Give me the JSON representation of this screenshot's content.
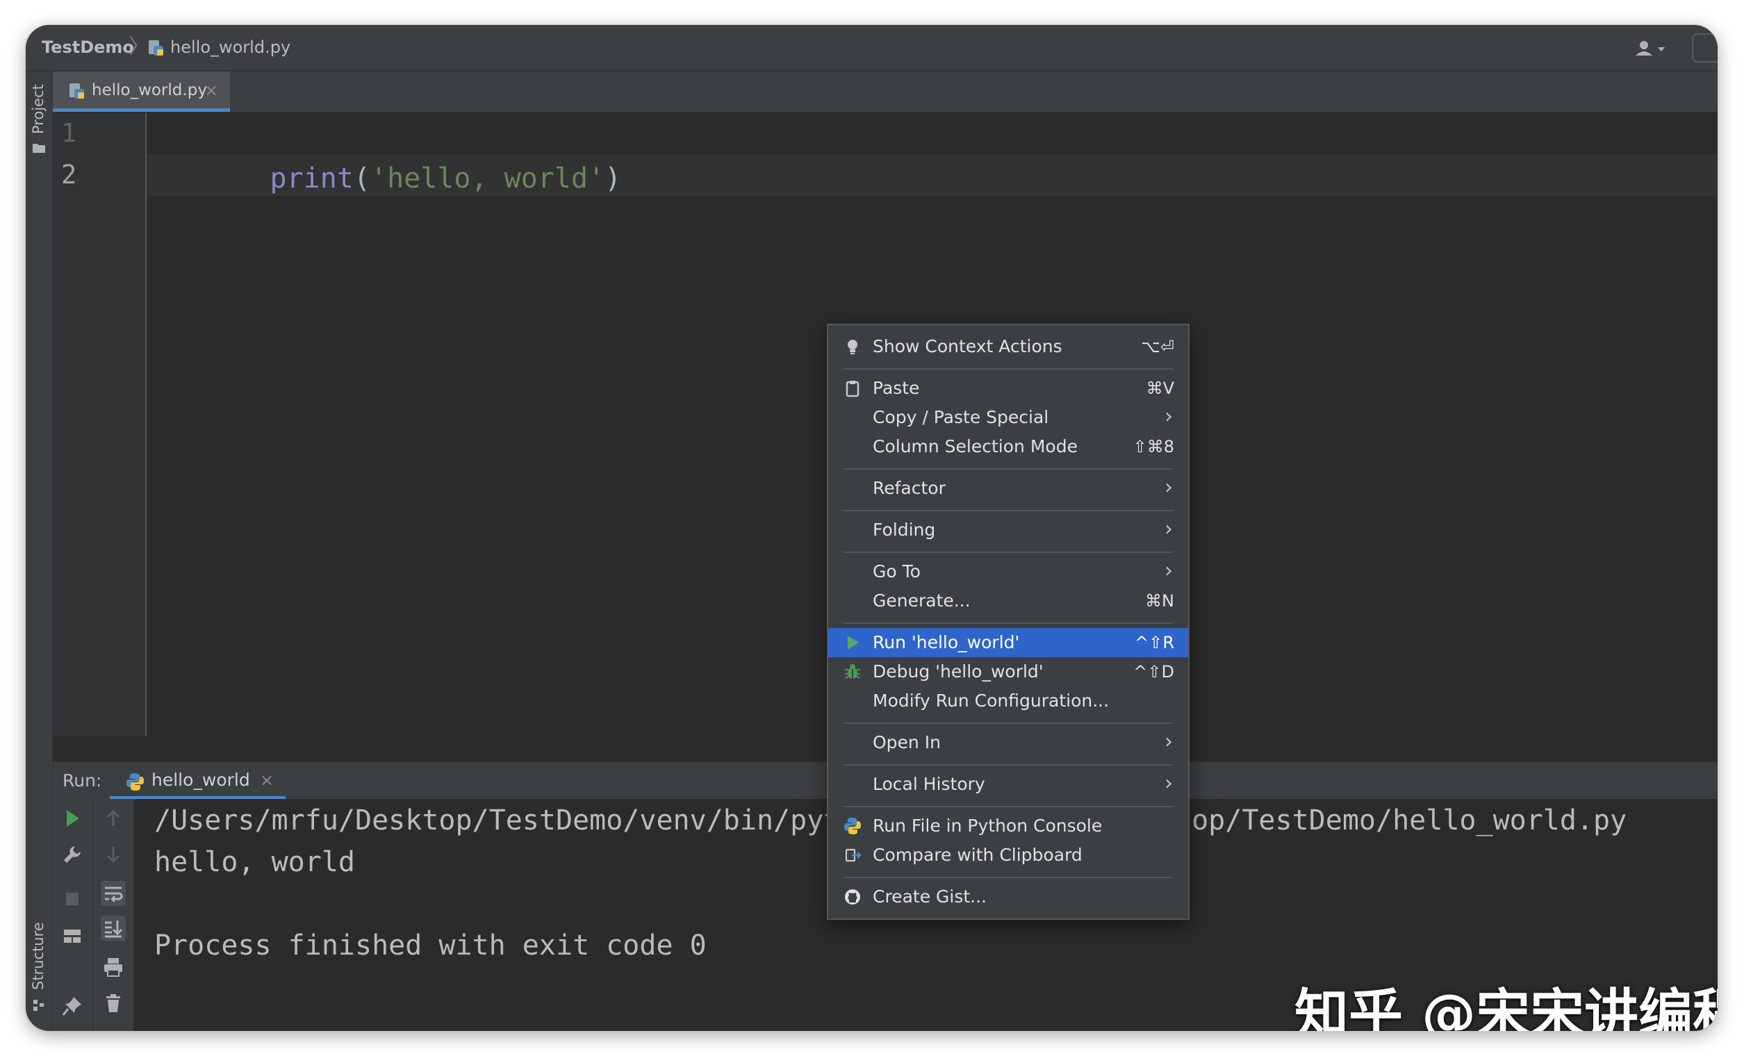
{
  "breadcrumb": {
    "project": "TestDemo",
    "file": "hello_world.py"
  },
  "sidebar": {
    "project_label": "Project",
    "structure_label": "Structure"
  },
  "editor": {
    "tab_label": "hello_world.py",
    "tab_close": "×",
    "line_numbers": [
      "1",
      "2"
    ],
    "code": {
      "fn": "print",
      "open": "(",
      "str": "'hello, world'",
      "close": ")"
    }
  },
  "run_panel": {
    "label": "Run:",
    "tab_label": "hello_world",
    "tab_close": "×",
    "console_lines": [
      "/Users/mrfu/Desktop/TestDemo/venv/bin/python /Users/mrfu/Desktop/TestDemo/hello_world.py",
      "hello, world",
      "",
      "Process finished with exit code 0"
    ]
  },
  "context_menu": {
    "items": [
      {
        "label": "Show Context Actions",
        "shortcut": "⌥⏎",
        "icon": "lightbulb-icon"
      },
      {
        "label": "Paste",
        "shortcut": "⌘V",
        "icon": "clipboard-icon"
      },
      {
        "label": "Copy / Paste Special",
        "submenu": true
      },
      {
        "label": "Column Selection Mode",
        "shortcut": "⇧⌘8"
      },
      {
        "label": "Refactor",
        "submenu": true
      },
      {
        "label": "Folding",
        "submenu": true
      },
      {
        "label": "Go To",
        "submenu": true
      },
      {
        "label": "Generate...",
        "shortcut": "⌘N"
      },
      {
        "label": "Run 'hello_world'",
        "shortcut": "^⇧R",
        "icon": "run-icon",
        "selected": true
      },
      {
        "label": "Debug 'hello_world'",
        "shortcut": "^⇧D",
        "icon": "debug-icon"
      },
      {
        "label": "Modify Run Configuration..."
      },
      {
        "label": "Open In",
        "submenu": true
      },
      {
        "label": "Local History",
        "submenu": true
      },
      {
        "label": "Run File in Python Console",
        "icon": "python-console-icon"
      },
      {
        "label": "Compare with Clipboard",
        "icon": "compare-icon"
      },
      {
        "label": "Create Gist...",
        "icon": "github-icon"
      }
    ],
    "chevron": "›"
  },
  "watermark": "知乎 @宋宋讲编程",
  "colors": {
    "editor_bg": "#2b2b2b",
    "panel_bg": "#3c3f41",
    "selection": "#2f65ca",
    "accent_tab": "#4a88c7",
    "string": "#6a8759",
    "builtin": "#8888c6",
    "run_green": "#499c54"
  }
}
